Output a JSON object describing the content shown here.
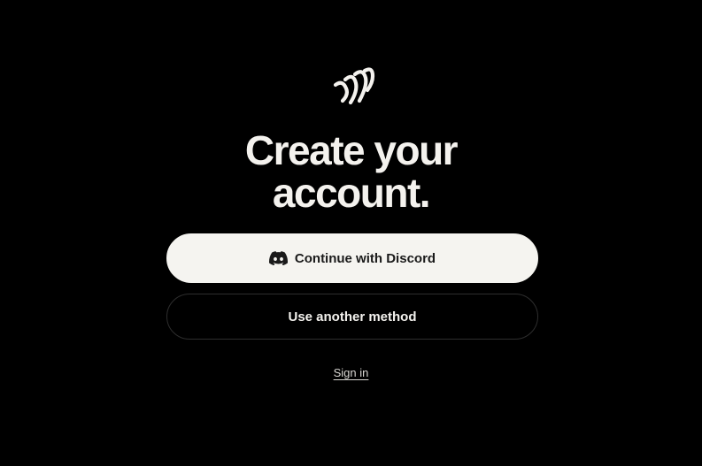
{
  "logo": {
    "icon": "wave-stripes-logo-icon"
  },
  "heading": {
    "line1": "Create your",
    "line2": "account."
  },
  "buttons": {
    "discord": {
      "label": "Continue with Discord",
      "icon": "discord-icon"
    },
    "other": {
      "label": "Use another method"
    }
  },
  "signin": {
    "label": "Sign in"
  },
  "colors": {
    "background": "#000000",
    "text": "#f4f2ee",
    "primary_button_bg": "#f5f4f0",
    "secondary_button_border": "#2e2e2e"
  }
}
